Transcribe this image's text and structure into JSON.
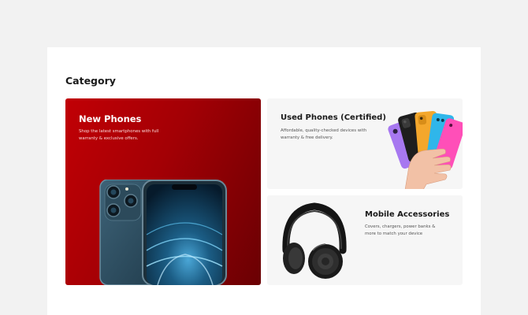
{
  "section": {
    "title": "Category"
  },
  "cards": {
    "new_phones": {
      "title": "New Phones",
      "description": "Shop the latest smartphones with full warranty & exclusive offers.",
      "image_icon": "smartphone-icon",
      "bg_color": "#b30004"
    },
    "used_phones": {
      "title": "Used Phones (Certified)",
      "description": "Affordable, quality-checked devices with warranty & free delivery.",
      "image_icon": "phones-fan-icon",
      "bg_color": "#f6f6f6"
    },
    "accessories": {
      "title": "Mobile Accessories",
      "description": "Covers, chargers, power banks & more to match your device",
      "image_icon": "headphones-icon",
      "bg_color": "#f6f6f6"
    }
  },
  "colors": {
    "page_bg": "#f2f2f2",
    "panel_bg": "#ffffff",
    "accent_red": "#c10005"
  }
}
